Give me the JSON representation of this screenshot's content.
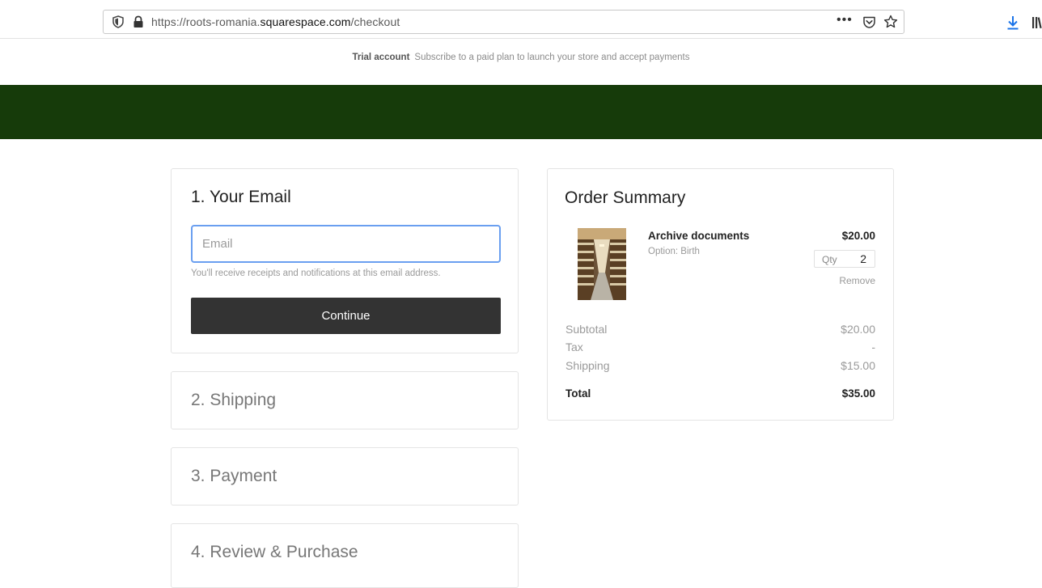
{
  "browser": {
    "url_prefix": "https://roots-romania.",
    "url_host": "squarespace.com",
    "url_path": "/checkout",
    "menu_dots": "•••"
  },
  "trial_banner": {
    "label": "Trial account",
    "message": "Subscribe to a paid plan to launch your store and accept payments"
  },
  "colors": {
    "header_band": "#163b0a",
    "button": "#333333",
    "input_focus": "#6a9ff0",
    "download_icon": "#1a73e8"
  },
  "checkout": {
    "email_step": {
      "title": "1. Your Email",
      "placeholder": "Email",
      "help_text": "You'll receive receipts and notifications at this email address.",
      "continue_label": "Continue"
    },
    "shipping_title": "2. Shipping",
    "payment_title": "3. Payment",
    "review_title": "4. Review & Purchase"
  },
  "order_summary": {
    "title": "Order Summary",
    "item": {
      "name": "Archive documents",
      "option": "Option: Birth",
      "price": "$20.00",
      "qty_label": "Qty",
      "qty_value": "2",
      "remove_label": "Remove"
    },
    "rows": [
      {
        "label": "Subtotal",
        "value": "$20.00"
      },
      {
        "label": "Tax",
        "value": "-"
      },
      {
        "label": "Shipping",
        "value": "$15.00"
      }
    ],
    "total": {
      "label": "Total",
      "value": "$35.00"
    }
  }
}
